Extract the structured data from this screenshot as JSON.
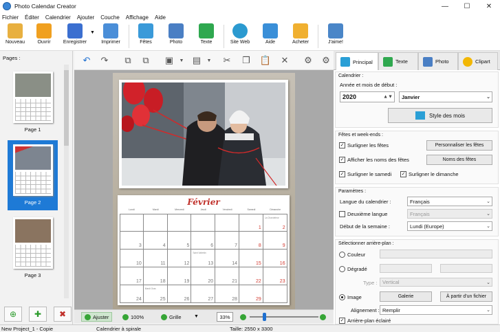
{
  "window": {
    "title": "Photo Calendar Creator",
    "controls": [
      "—",
      "☐",
      "✕"
    ]
  },
  "menu": [
    "Fichier",
    "Éditer",
    "Calendrier",
    "Ajouter",
    "Couche",
    "Affichage",
    "Aide"
  ],
  "toolbar": {
    "buttons": [
      {
        "label": "Nouveau",
        "icon": "new-document-icon",
        "color": "#e8b040"
      },
      {
        "label": "Ouvrir",
        "icon": "open-folder-icon",
        "color": "#f0a020"
      },
      {
        "label": "Enregistrer",
        "icon": "save-icon",
        "color": "#3b6fd0"
      },
      {
        "label": "Imprimer",
        "icon": "printer-icon",
        "color": "#4a8ed8"
      },
      {
        "label": "Fêtes",
        "icon": "holidays-calendar-icon",
        "color": "#3a9ad9"
      },
      {
        "label": "Photo",
        "icon": "camera-icon",
        "color": "#4a7fc4"
      },
      {
        "label": "Texte",
        "icon": "text-a-icon",
        "color": "#2fa84f"
      },
      {
        "label": "Site Web",
        "icon": "globe-icon",
        "color": "#2b9ad0"
      },
      {
        "label": "Aide",
        "icon": "help-book-icon",
        "color": "#3a8fd8"
      },
      {
        "label": "Acheter",
        "icon": "shopping-bag-icon",
        "color": "#f0b030"
      },
      {
        "label": "J'aime!",
        "icon": "thumbs-up-icon",
        "color": "#4a86c8"
      }
    ]
  },
  "pages_panel": {
    "label": "Pages :",
    "pages": [
      {
        "caption": "Page 1",
        "photo_color": "#8a8f86"
      },
      {
        "caption": "Page 2",
        "photo_color": "#7d8590"
      },
      {
        "caption": "Page 3",
        "photo_color": "#8a7460"
      }
    ]
  },
  "calendar": {
    "month": "Février",
    "day_headers": [
      "Lundi",
      "Mardi",
      "Mercredi",
      "Jeudi",
      "Vendredi",
      "Samedi",
      "Dimanche"
    ],
    "rows": [
      [
        "",
        "",
        "",
        "",
        "",
        "1",
        "2"
      ],
      [
        "3",
        "4",
        "5",
        "6",
        "7",
        "8",
        "9"
      ],
      [
        "10",
        "11",
        "12",
        "13",
        "14",
        "15",
        "16"
      ],
      [
        "17",
        "18",
        "19",
        "20",
        "21",
        "22",
        "23"
      ],
      [
        "24",
        "25",
        "26",
        "27",
        "28",
        "29",
        ""
      ]
    ],
    "notes": {
      "0-6": "La Chandeleur",
      "2-3": "Saint Valentin",
      "4-1": "Mardi Gras"
    }
  },
  "bottom_bar": {
    "fit": "Ajuster",
    "zoom100": "100%",
    "grid": "Grille",
    "zoom": "33%"
  },
  "right_panel": {
    "tabs": [
      {
        "label": "Principal",
        "icon": "principal-tab-icon",
        "color": "#2a9fd6"
      },
      {
        "label": "Texte",
        "icon": "text-tab-icon",
        "color": "#2fa84f"
      },
      {
        "label": "Photo",
        "icon": "photo-tab-icon",
        "color": "#4a7fc4"
      },
      {
        "label": "Clipart",
        "icon": "star-icon",
        "color": "#f2b705"
      }
    ],
    "calendrier": {
      "title": "Calendrier :",
      "year_month_label": "Année et mois de début :",
      "year": "2020",
      "month": "Janvier",
      "style_button": "Style des mois"
    },
    "fetes": {
      "title": "Fêtes et week-ends :",
      "highlight_holidays": "Surligner les fêtes",
      "customize_holidays": "Personnaliser les fêtes",
      "show_names": "Afficher les noms des fêtes",
      "holiday_names": "Noms des fêtes",
      "highlight_saturday": "Surligner le samedi",
      "highlight_sunday": "Surligner le dimanche"
    },
    "parametres": {
      "title": "Paramètres :",
      "language_label": "Langue du calendrier :",
      "language": "Français",
      "second_language_label": "Deuxième langue",
      "second_language": "Français",
      "week_start_label": "Début de la semaine :",
      "week_start": "Lundi (Europe)"
    },
    "arriere_plan": {
      "title": "Sélectionner arrière-plan :",
      "color": "Couleur",
      "gradient": "Dégradé",
      "type_label": "Type :",
      "type_value": "Vertical",
      "image": "Image",
      "gallery": "Galerie",
      "from_file": "À partir d'un fichier",
      "alignment_label": "Alignement :",
      "alignment": "Remplir",
      "lighten": "Arrière-plan éclairé"
    }
  },
  "status": {
    "project": "New Project_1 - Copie",
    "type": "Calendrier à spirale",
    "size": "Taille: 2550 x 3300"
  }
}
